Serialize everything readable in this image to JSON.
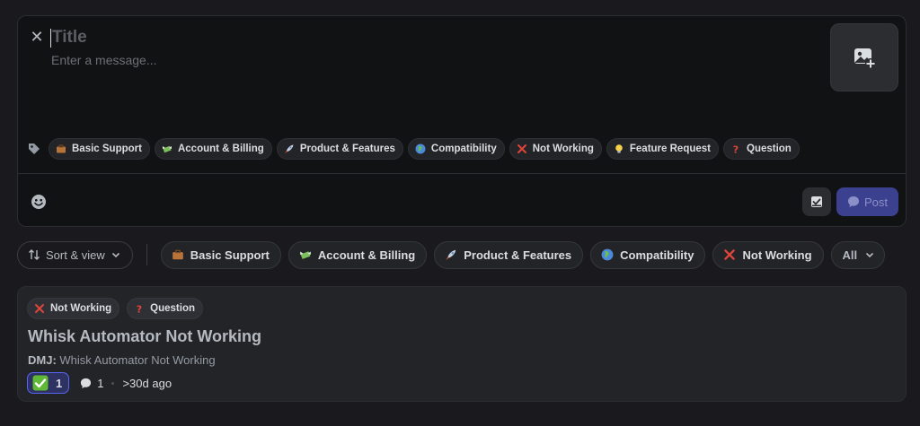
{
  "composer": {
    "title_placeholder": "Title",
    "message_placeholder": "Enter a message...",
    "tags": [
      {
        "icon": "briefcase-icon",
        "label": "Basic Support"
      },
      {
        "icon": "money-wings-icon",
        "label": "Account & Billing"
      },
      {
        "icon": "rocket-icon",
        "label": "Product & Features"
      },
      {
        "icon": "globe-icon",
        "label": "Compatibility"
      },
      {
        "icon": "red-x-icon",
        "label": "Not Working"
      },
      {
        "icon": "lightbulb-icon",
        "label": "Feature Request"
      },
      {
        "icon": "question-mark-icon",
        "label": "Question"
      }
    ],
    "post_label": "Post"
  },
  "filters": {
    "sort_label": "Sort & view",
    "chips": [
      {
        "icon": "briefcase-icon",
        "label": "Basic Support"
      },
      {
        "icon": "money-wings-icon",
        "label": "Account & Billing"
      },
      {
        "icon": "rocket-icon",
        "label": "Product & Features"
      },
      {
        "icon": "globe-icon",
        "label": "Compatibility"
      },
      {
        "icon": "red-x-icon",
        "label": "Not Working"
      }
    ],
    "all_label": "All"
  },
  "post": {
    "tags": [
      {
        "icon": "red-x-icon",
        "label": "Not Working"
      },
      {
        "icon": "question-mark-icon",
        "label": "Question"
      }
    ],
    "title": "Whisk Automator Not Working",
    "preview_author": "DMJ:",
    "preview_text": " Whisk Automator Not Working",
    "reaction_count": "1",
    "reply_count": "1",
    "age": ">30d ago"
  },
  "colors": {
    "background": "#1a1a1e",
    "surface": "#232428",
    "accent": "#5865f2",
    "post_button": "#3c418f"
  }
}
